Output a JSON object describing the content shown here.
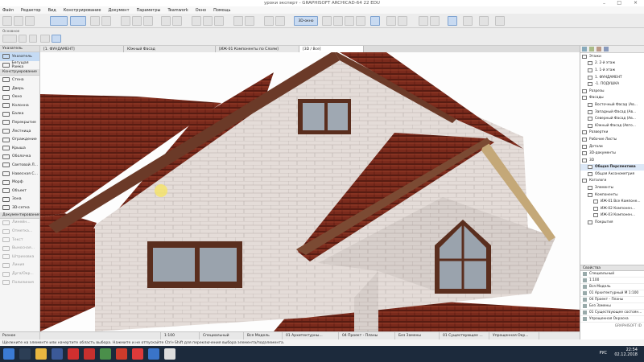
{
  "window": {
    "title": "уроки эксперт - GRAPHISOFT ARCHICAD-64 22 EDU"
  },
  "menu": [
    "Файл",
    "Редактор",
    "Вид",
    "Конструирование",
    "Документ",
    "Параметры",
    "Teamwork",
    "Окно",
    "Помощь"
  ],
  "toolbar": {
    "view_3d_label": "3D-окно",
    "osnovnoe": "Основное"
  },
  "toolbox": {
    "sections": [
      {
        "label": "Указатель",
        "items": [
          {
            "label": "Указатель",
            "selected": true
          },
          {
            "label": "Бегущая Рамка"
          }
        ]
      },
      {
        "label": "Конструирование",
        "items": [
          {
            "label": "Стена"
          },
          {
            "label": "Дверь"
          },
          {
            "label": "Окно"
          },
          {
            "label": "Колонна"
          },
          {
            "label": "Балка"
          },
          {
            "label": "Перекрытие"
          },
          {
            "label": "Лестница"
          },
          {
            "label": "Ограждение"
          },
          {
            "label": "Крыша"
          },
          {
            "label": "Оболочка"
          },
          {
            "label": "Световой Л..."
          },
          {
            "label": "Навесная С..."
          },
          {
            "label": "Морф"
          },
          {
            "label": "Объект"
          },
          {
            "label": "Зона"
          },
          {
            "label": "3D-сетка"
          }
        ]
      },
      {
        "label": "Документирование",
        "items": [
          {
            "label": "Линейн...",
            "dim": true
          },
          {
            "label": "Отметка...",
            "dim": true
          },
          {
            "label": "Текст",
            "dim": true
          },
          {
            "label": "Выносная...",
            "dim": true
          },
          {
            "label": "Штриховка",
            "dim": true
          },
          {
            "label": "Линия",
            "dim": true
          },
          {
            "label": "Дуга/Окр...",
            "dim": true
          },
          {
            "label": "Полилиния",
            "dim": true
          }
        ]
      }
    ],
    "more": "Разное"
  },
  "tabs": [
    {
      "label": "[1. ФУНДАМЕНТ]"
    },
    {
      "label": "Южный Фасад"
    },
    {
      "label": "[ИЖ-01 Компоненты по Слоям]"
    },
    {
      "label": "[3D / Все]",
      "active": true
    }
  ],
  "navigator": {
    "tree": [
      {
        "label": "Этажи",
        "level": 1
      },
      {
        "label": "2. 2-й этаж",
        "level": 2
      },
      {
        "label": "1. 1-й этаж",
        "level": 2
      },
      {
        "label": "1. ФУНДАМЕНТ",
        "level": 2
      },
      {
        "label": "-1. ПОДУШКА",
        "level": 2
      },
      {
        "label": "Разрезы",
        "level": 1
      },
      {
        "label": "Фасады",
        "level": 1
      },
      {
        "label": "Восточный Фасад (Ав...",
        "level": 2
      },
      {
        "label": "Западный Фасад (Ав...",
        "level": 2
      },
      {
        "label": "Северный Фасад (Ав...",
        "level": 2
      },
      {
        "label": "Южный Фасад (Авто...",
        "level": 2
      },
      {
        "label": "Развертки",
        "level": 1
      },
      {
        "label": "Рабочие Листы",
        "level": 1
      },
      {
        "label": "Детали",
        "level": 1
      },
      {
        "label": "3D-документы",
        "level": 1
      },
      {
        "label": "3D",
        "level": 1
      },
      {
        "label": "Общая Перспектива",
        "level": 2,
        "selected": true
      },
      {
        "label": "Общая Аксонометрия",
        "level": 2
      },
      {
        "label": "Каталоги",
        "level": 1
      },
      {
        "label": "Элементы",
        "level": 2
      },
      {
        "label": "Компоненты",
        "level": 2
      },
      {
        "label": "ИЖ-01 Все Компоне...",
        "level": 3
      },
      {
        "label": "ИЖ-02 Компонен...",
        "level": 3
      },
      {
        "label": "ИЖ-03 Компонен...",
        "level": 3
      },
      {
        "label": "Покрытия",
        "level": 2
      }
    ]
  },
  "properties": {
    "title": "Свойства",
    "rows": [
      "Специальный",
      "1:100",
      "Вся Модель",
      "01 Архитектурный М 1:100",
      "04 Проект - Планы",
      "Без Замены",
      "01 Существующее состоян...",
      "Упрощенная Окраска"
    ],
    "footer": "GRAPHISOFT ID"
  },
  "status": {
    "scale": "1:100",
    "layer": "Специальный",
    "model": "Вся Модель",
    "pen": "01 Архитектурны...",
    "plan": "04 Проект - Планы",
    "override": "Без Замены",
    "renov": "01 Существующее ...",
    "surface": "Упрощенная Окр..."
  },
  "hint": "Щелкните на элементе или начертите область выбора. Нажмите и не отпускайте Ctrl+Shift для переключения выбора элемента/подэлемента.",
  "taskbar": {
    "time": "22:54",
    "date": "02.12.2018",
    "lang": "РУС"
  }
}
